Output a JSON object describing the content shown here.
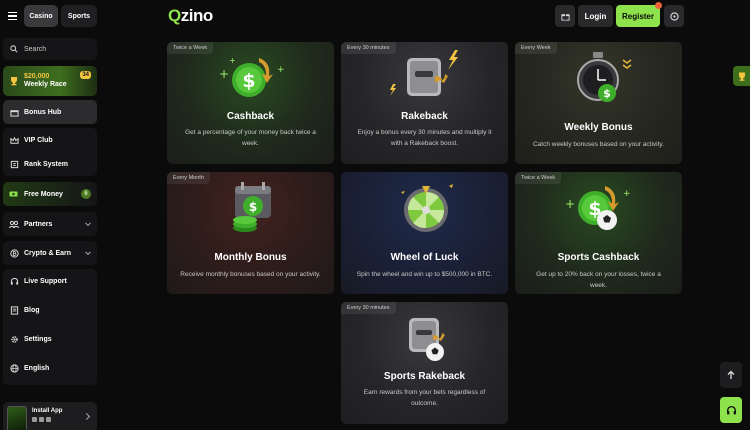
{
  "topbar": {
    "tabs": [
      {
        "label": "Casino"
      },
      {
        "label": "Sports"
      }
    ],
    "logo_prefix": "Q",
    "logo_rest": "zino",
    "login_label": "Login",
    "register_label": "Register"
  },
  "sidebar": {
    "search_label": "Search",
    "race": {
      "amount": "$20,000",
      "label": "Weekly Race",
      "badge": "34"
    },
    "bonus_hub": "Bonus Hub",
    "vip_club": "VIP Club",
    "rank_system": "Rank System",
    "free_money": {
      "label": "Free Money",
      "badge": "6"
    },
    "partners": "Partners",
    "crypto_earn": "Crypto & Earn",
    "live_support": "Live Support",
    "blog": "Blog",
    "settings": "Settings",
    "language": "English",
    "install_app": "Install App"
  },
  "cards": [
    {
      "tag": "Twice a Week",
      "title": "Cashback",
      "desc": "Get a percentage of your money back twice a week."
    },
    {
      "tag": "Every 30 minutes",
      "title": "Rakeback",
      "desc": "Enjoy a bonus every 30 minutes and multiply it with a Rakeback boost."
    },
    {
      "tag": "Every Week",
      "title": "Weekly Bonus",
      "desc": "Catch weekly bonuses based on your activity."
    },
    {
      "tag": "Every Month",
      "title": "Monthly Bonus",
      "desc": "Receive monthly bonuses based on your activity."
    },
    {
      "tag": "",
      "title": "Wheel of Luck",
      "desc": "Spin the wheel and win up to $500,000 in BTC."
    },
    {
      "tag": "Twice a Week",
      "title": "Sports Cashback",
      "desc": "Get up to 20% back on your losses, twice a week."
    },
    {
      "tag": "Every 30 minutes",
      "title": "Sports Rakeback",
      "desc": "Earn rewards from your bets regardless of outcome."
    }
  ],
  "colors": {
    "accent": "#8ee24b",
    "background": "#0b0b0c",
    "gold": "#f5c542"
  }
}
